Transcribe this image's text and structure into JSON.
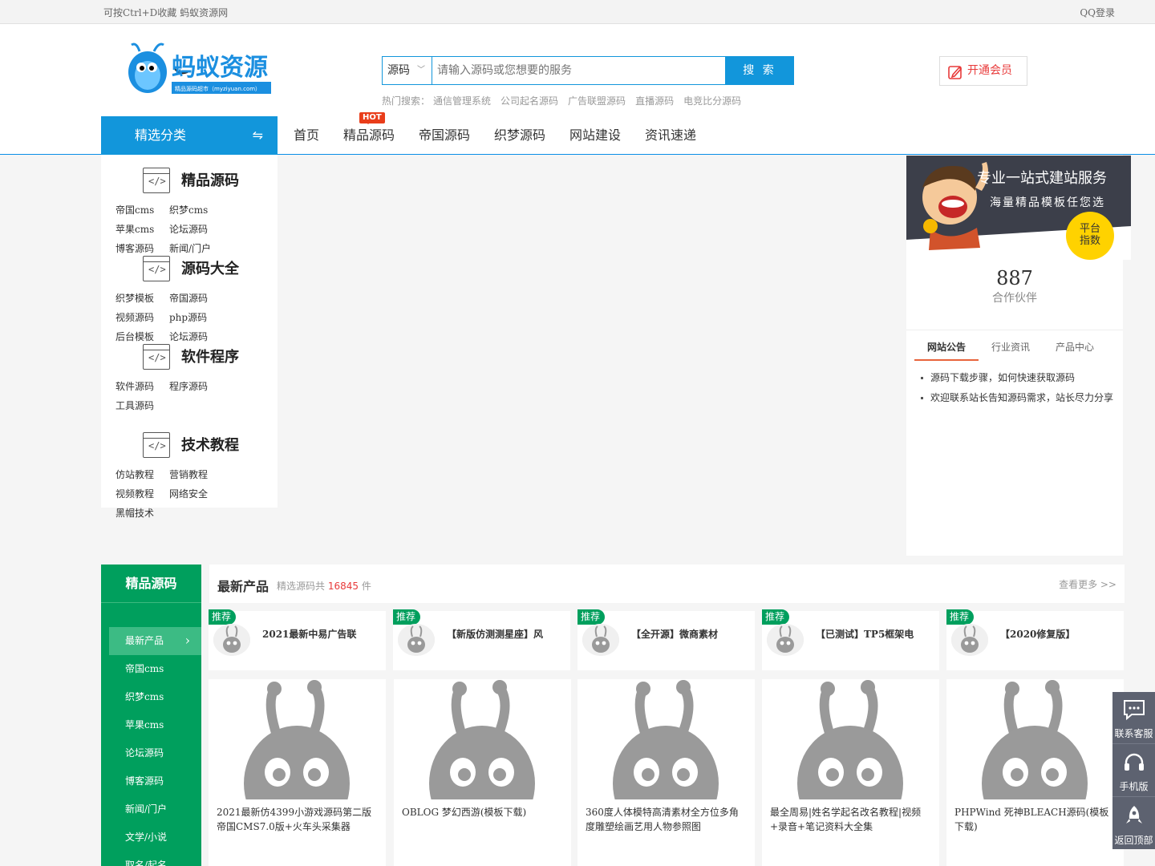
{
  "topbar": {
    "bookmark_tip": "可按Ctrl+D收藏 蚂蚁资源网",
    "login": "QQ登录"
  },
  "logo": {
    "name": "蚂蚁资源",
    "tagline": "精品源码超市（myziyuan.com）"
  },
  "search": {
    "category": "源码",
    "placeholder": "请输入源码或您想要的服务",
    "button": "搜 索"
  },
  "hot_search": {
    "label": "热门搜索：",
    "terms": [
      "通信管理系统",
      "公司起名源码",
      "广告联盟源码",
      "直播源码",
      "电竞比分源码"
    ]
  },
  "vip": {
    "label": "开通会员"
  },
  "nav": {
    "category_label": "精选分类",
    "hot_badge": "HOT",
    "items": [
      "首页",
      "精品源码",
      "帝国源码",
      "织梦源码",
      "网站建设",
      "资讯速递"
    ]
  },
  "categories": [
    {
      "title": "精品源码",
      "links": [
        "帝国cms",
        "织梦cms",
        "苹果cms",
        "论坛源码",
        "博客源码",
        "新闻/门户"
      ]
    },
    {
      "title": "源码大全",
      "links": [
        "织梦模板",
        "帝国源码",
        "视频源码",
        "php源码",
        "后台模板",
        "论坛源码"
      ]
    },
    {
      "title": "软件程序",
      "links": [
        "软件源码",
        "程序源码",
        "工具源码"
      ]
    },
    {
      "title": "技术教程",
      "links": [
        "仿站教程",
        "营销教程",
        "视频教程",
        "网络安全",
        "黑帽技术"
      ]
    }
  ],
  "banner": {
    "title": "专业一站式建站服务",
    "subtitle": "海量精品模板任您选",
    "badge_line1": "平台",
    "badge_line2": "指数"
  },
  "stats": {
    "count": "887",
    "label": "合作伙伴"
  },
  "right_tabs": [
    "网站公告",
    "行业资讯",
    "产品中心"
  ],
  "notices": [
    "源码下载步骤，如何快速获取源码",
    "欢迎联系站长告知源码需求，站长尽力分享"
  ],
  "section": {
    "side_title": "精品源码",
    "side_items": [
      "最新产品",
      "帝国cms",
      "织梦cms",
      "苹果cms",
      "论坛源码",
      "博客源码",
      "新闻/门户",
      "文学/小说",
      "取名/起名"
    ],
    "head_title": "最新产品",
    "head_sub_prefix": "精选源码共",
    "head_count": "16845",
    "head_sub_suffix": "件",
    "more": "查看更多 >>"
  },
  "recommended": {
    "tag": "推荐",
    "items": [
      "2021最新中易广告联",
      "【新版仿测测星座】风",
      "【全开源】微商素材",
      "【已测试】TP5框架电",
      "【2020修复版】"
    ]
  },
  "products": [
    "2021最新仿4399小游戏源码第二版帝国CMS7.0版+火车头采集器",
    "OBLOG 梦幻西游(模板下载)",
    "360度人体模特高清素材全方位多角度雕塑绘画艺用人物参照图",
    "最全周易|姓名学起名改名教程|视频+录音+笔记资料大全集",
    "PHPWind 死神BLEACH源码(模板下载)"
  ],
  "float_bar": [
    "联系客服",
    "手机版",
    "返回顶部"
  ],
  "colors": {
    "brand_blue": "#1296db",
    "green": "#009f5d",
    "red": "#e83a3a"
  }
}
